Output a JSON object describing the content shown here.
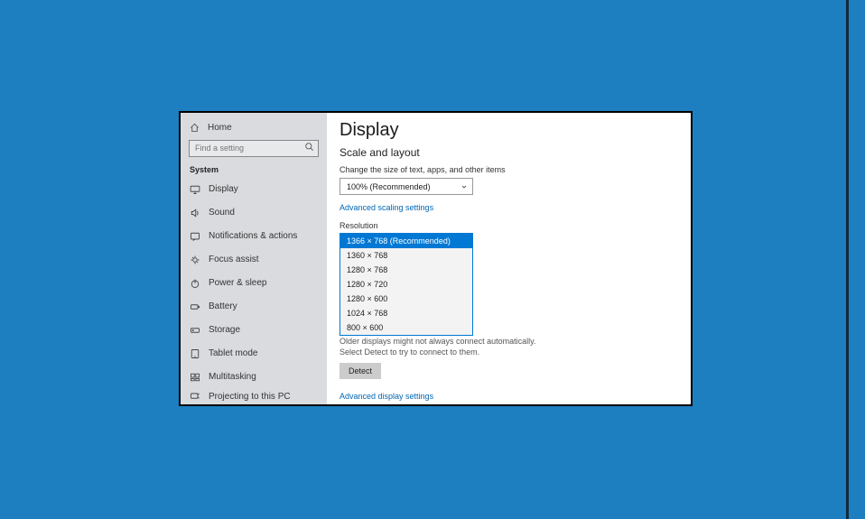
{
  "sidebar": {
    "home": "Home",
    "search_placeholder": "Find a setting",
    "section": "System",
    "items": [
      {
        "label": "Display",
        "icon": "display"
      },
      {
        "label": "Sound",
        "icon": "sound"
      },
      {
        "label": "Notifications & actions",
        "icon": "notifications"
      },
      {
        "label": "Focus assist",
        "icon": "focus"
      },
      {
        "label": "Power & sleep",
        "icon": "power"
      },
      {
        "label": "Battery",
        "icon": "battery"
      },
      {
        "label": "Storage",
        "icon": "storage"
      },
      {
        "label": "Tablet mode",
        "icon": "tablet"
      },
      {
        "label": "Multitasking",
        "icon": "multitask"
      },
      {
        "label": "Projecting to this PC",
        "icon": "projecting"
      }
    ]
  },
  "main": {
    "title": "Display",
    "subtitle": "Scale and layout",
    "scale_label": "Change the size of text, apps, and other items",
    "scale_value": "100% (Recommended)",
    "advanced_scaling_link": "Advanced scaling settings",
    "resolution_label": "Resolution",
    "resolution_options": [
      "1366 × 768 (Recommended)",
      "1360 × 768",
      "1280 × 768",
      "1280 × 720",
      "1280 × 600",
      "1024 × 768",
      "800 × 600"
    ],
    "resolution_selected_index": 0,
    "detect_help": "Older displays might not always connect automatically. Select Detect to try to connect to them.",
    "detect_button": "Detect",
    "advanced_display_link": "Advanced display settings"
  }
}
